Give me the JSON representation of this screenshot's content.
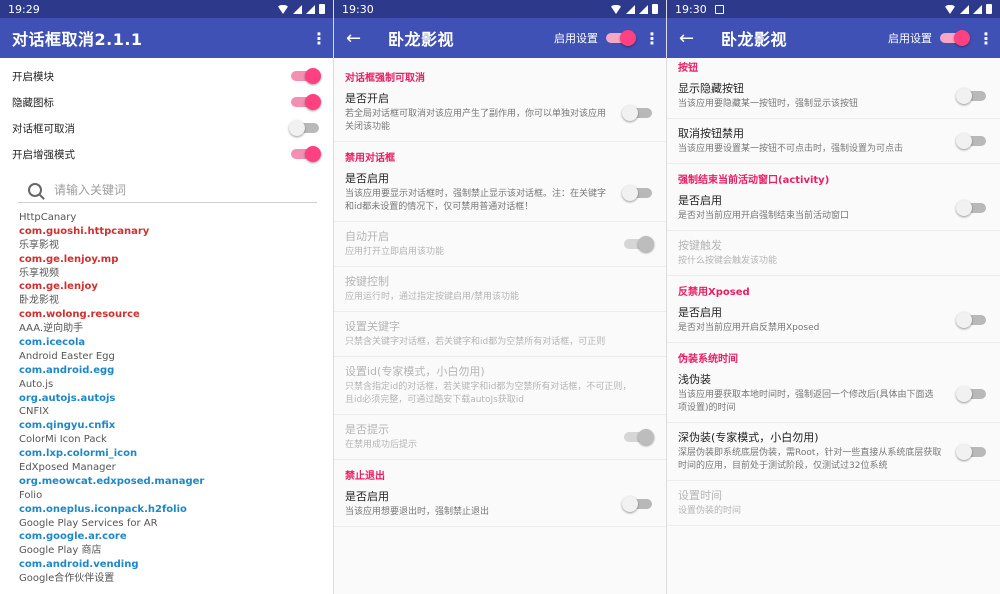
{
  "panel1": {
    "time": "19:29",
    "title": "对话框取消2.1.1",
    "toggles": [
      {
        "label": "开启模块",
        "on": true
      },
      {
        "label": "隐藏图标",
        "on": true
      },
      {
        "label": "对话框可取消",
        "on": false
      },
      {
        "label": "开启增强模式",
        "on": true
      }
    ],
    "search_placeholder": "请输入关键词",
    "apps": [
      {
        "name": "HttpCanary",
        "style": "nm"
      },
      {
        "name": "com.guoshi.httpcanary",
        "style": "red"
      },
      {
        "name": "乐享影视",
        "style": "nm"
      },
      {
        "name": "com.ge.lenjoy.mp",
        "style": "red"
      },
      {
        "name": "乐享视频",
        "style": "nm"
      },
      {
        "name": "com.ge.lenjoy",
        "style": "red"
      },
      {
        "name": "卧龙影视",
        "style": "nm"
      },
      {
        "name": "com.wolong.resource",
        "style": "red"
      },
      {
        "name": "AAA.逆向助手",
        "style": "nm"
      },
      {
        "name": "com.icecola",
        "style": "blue"
      },
      {
        "name": "Android Easter Egg",
        "style": "nm"
      },
      {
        "name": "com.android.egg",
        "style": "blue"
      },
      {
        "name": "Auto.js",
        "style": "nm"
      },
      {
        "name": "org.autojs.autojs",
        "style": "blue"
      },
      {
        "name": "CNFIX",
        "style": "nm"
      },
      {
        "name": "com.qingyu.cnfix",
        "style": "blue"
      },
      {
        "name": "ColorMi Icon Pack",
        "style": "nm"
      },
      {
        "name": "com.lxp.colormi_icon",
        "style": "blue"
      },
      {
        "name": "EdXposed Manager",
        "style": "nm"
      },
      {
        "name": "org.meowcat.edxposed.manager",
        "style": "blue"
      },
      {
        "name": "Folio",
        "style": "nm"
      },
      {
        "name": "com.oneplus.iconpack.h2folio",
        "style": "blue"
      },
      {
        "name": "Google Play Services for AR",
        "style": "nm"
      },
      {
        "name": "com.google.ar.core",
        "style": "blue"
      },
      {
        "name": "Google Play 商店",
        "style": "nm"
      },
      {
        "name": "com.android.vending",
        "style": "blue"
      },
      {
        "name": "Google合作伙伴设置",
        "style": "nm"
      }
    ]
  },
  "panel2": {
    "time": "19:30",
    "title": "卧龙影视",
    "enable_label": "启用设置",
    "enabled": true,
    "items": [
      {
        "kind": "section",
        "text": "对话框强制可取消"
      },
      {
        "kind": "pref",
        "title": "是否开启",
        "summary": "若全局对话框可取消对该应用产生了副作用，你可以单独对该应用关闭该功能",
        "switch": "off",
        "disabled": false
      },
      {
        "kind": "section",
        "text": "禁用对话框"
      },
      {
        "kind": "pref",
        "title": "是否启用",
        "summary": "当该应用要显示对话框时，强制禁止显示该对话框。注：在关键字和id都未设置的情况下，仅可禁用普通对话框！",
        "switch": "off",
        "disabled": false
      },
      {
        "kind": "pref",
        "title": "自动开启",
        "summary": "应用打开立即启用该功能",
        "switch": "dis",
        "disabled": true
      },
      {
        "kind": "pref",
        "title": "按键控制",
        "summary": "应用运行时，通过指定按键启用/禁用该功能",
        "switch": "",
        "disabled": true
      },
      {
        "kind": "pref",
        "title": "设置关键字",
        "summary": "只禁含关键字对话框，若关键字和id都为空禁所有对话框，可正则",
        "switch": "",
        "disabled": true
      },
      {
        "kind": "pref",
        "title": "设置id(专家模式，小白勿用)",
        "summary": "只禁含指定id的对话框，若关键字和id都为空禁所有对话框，不可正则，且id必须完整，可通过酷安下载autoJs获取id",
        "switch": "",
        "disabled": true
      },
      {
        "kind": "pref",
        "title": "是否提示",
        "summary": "在禁用成功后提示",
        "switch": "dis",
        "disabled": true
      },
      {
        "kind": "section",
        "text": "禁止退出"
      },
      {
        "kind": "pref",
        "title": "是否启用",
        "summary": "当该应用想要退出时，强制禁止退出",
        "switch": "off",
        "disabled": false
      }
    ]
  },
  "panel3": {
    "time": "19:30",
    "title": "卧龙影视",
    "enable_label": "启用设置",
    "enabled": true,
    "items": [
      {
        "kind": "section",
        "text": "按钮"
      },
      {
        "kind": "pref",
        "title": "显示隐藏按钮",
        "summary": "当该应用要隐藏某一按钮时，强制显示该按钮",
        "switch": "off",
        "disabled": false
      },
      {
        "kind": "pref",
        "title": "取消按钮禁用",
        "summary": "当该应用要设置某一按钮不可点击时，强制设置为可点击",
        "switch": "off",
        "disabled": false
      },
      {
        "kind": "section",
        "text": "强制结束当前活动窗口(activity)"
      },
      {
        "kind": "pref",
        "title": "是否启用",
        "summary": "是否对当前应用开启强制结束当前活动窗口",
        "switch": "off",
        "disabled": false
      },
      {
        "kind": "pref",
        "title": "按键触发",
        "summary": "按什么按键会触发该功能",
        "switch": "",
        "disabled": true
      },
      {
        "kind": "section",
        "text": "反禁用Xposed"
      },
      {
        "kind": "pref",
        "title": "是否启用",
        "summary": "是否对当前应用开启反禁用Xposed",
        "switch": "off",
        "disabled": false
      },
      {
        "kind": "section",
        "text": "伪装系统时间"
      },
      {
        "kind": "pref",
        "title": "浅伪装",
        "summary": "当该应用要获取本地时间时，强制返回一个修改后(具体由下面选项设置)的时间",
        "switch": "off",
        "disabled": false
      },
      {
        "kind": "pref",
        "title": "深伪装(专家模式，小白勿用)",
        "summary": "深层伪装即系统底层伪装，需Root，针对一些直接从系统底层获取时间的应用，目前处于测试阶段，仅测试过32位系统",
        "switch": "off",
        "disabled": false
      },
      {
        "kind": "pref",
        "title": "设置时间",
        "summary": "设置伪装的时间",
        "switch": "",
        "disabled": true
      }
    ]
  },
  "colors": {
    "primary": "#3f51b5",
    "status": "#2d3a8c",
    "accent": "#ff4081",
    "section": "#e91e63"
  }
}
